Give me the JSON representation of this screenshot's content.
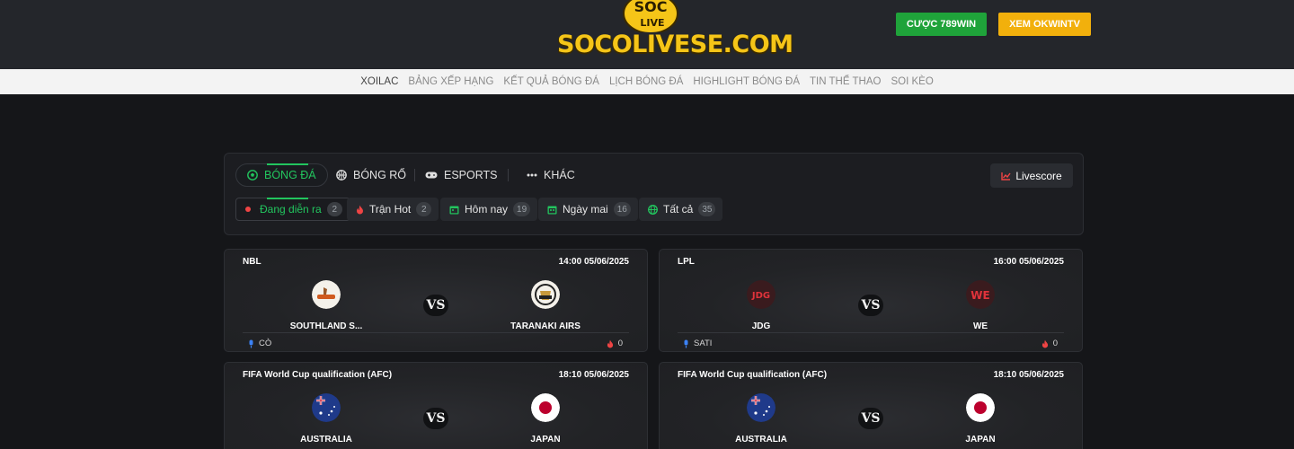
{
  "header": {
    "logo_badge_top": "SOC",
    "logo_badge_bottom": "LIVE",
    "logo_text": "SOCOLIVESE.COM",
    "btn_green": "CƯỢC 789WIN",
    "btn_yellow": "XEM OKWINTV",
    "colors": {
      "green": "#1fa33a",
      "yellow": "#f2b00c",
      "logo": "#f5c518"
    }
  },
  "nav": [
    "XOILAC",
    "BẢNG XẾP HẠNG",
    "KẾT QUẢ BÓNG ĐÁ",
    "LỊCH BÓNG ĐÁ",
    "HIGHLIGHT BÓNG ĐÁ",
    "TIN THỂ THAO",
    "SOI KÈO"
  ],
  "sports": [
    {
      "label": "BÓNG ĐÁ",
      "icon": "soccer-ball-icon"
    },
    {
      "label": "BÓNG RỔ",
      "icon": "basketball-icon"
    },
    {
      "label": "ESPORTS",
      "icon": "gamepad-icon"
    },
    {
      "label": "KHÁC",
      "icon": "more-dots-icon"
    }
  ],
  "livescore": "Livescore",
  "filters": [
    {
      "label": "Đang diễn ra",
      "count": "2",
      "icon": "live-dot-icon"
    },
    {
      "label": "Trận Hot",
      "count": "2",
      "icon": "fire-icon"
    },
    {
      "label": "Hôm nay",
      "count": "19",
      "icon": "calendar-icon"
    },
    {
      "label": "Ngày mai",
      "count": "16",
      "icon": "calendar-icon"
    },
    {
      "label": "Tất cả",
      "count": "35",
      "icon": "globe-icon"
    }
  ],
  "vs_label": "VS",
  "matches": [
    {
      "league": "NBL",
      "time": "14:00 05/06/2025",
      "home": "SOUTHLAND S...",
      "away": "TARANAKI AIRS",
      "caster": "CÒ",
      "views": "0"
    },
    {
      "league": "LPL",
      "time": "16:00 05/06/2025",
      "home": "JDG",
      "away": "WE",
      "caster": "SATI",
      "views": "0"
    },
    {
      "league": "FIFA World Cup qualification (AFC)",
      "time": "18:10 05/06/2025",
      "home": "AUSTRALIA",
      "away": "JAPAN",
      "caster": "",
      "views": ""
    },
    {
      "league": "FIFA World Cup qualification (AFC)",
      "time": "18:10 05/06/2025",
      "home": "AUSTRALIA",
      "away": "JAPAN",
      "caster": "",
      "views": ""
    }
  ]
}
